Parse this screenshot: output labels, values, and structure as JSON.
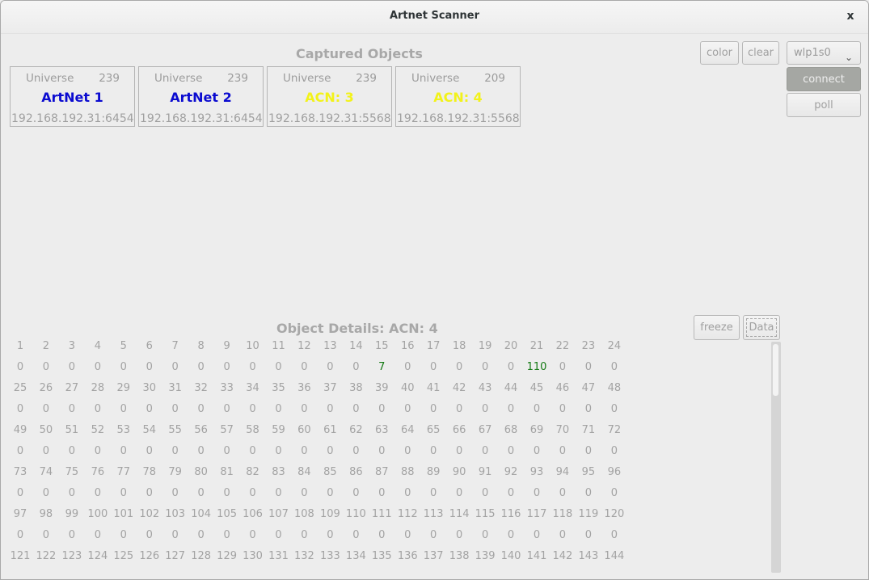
{
  "window": {
    "title": "Artnet Scanner",
    "close_label": "x"
  },
  "captured": {
    "title": "Captured Objects",
    "objects": [
      {
        "universe_label": "Universe",
        "universe": "239",
        "name": "ArtNet 1",
        "address": "192.168.192.31:6454",
        "color": "#0b0bd0"
      },
      {
        "universe_label": "Universe",
        "universe": "239",
        "name": "ArtNet 2",
        "address": "192.168.192.31:6454",
        "color": "#0b0bd0"
      },
      {
        "universe_label": "Universe",
        "universe": "239",
        "name": "ACN: 3",
        "address": "192.168.192.31:5568",
        "color": "#f2f21a"
      },
      {
        "universe_label": "Universe",
        "universe": "209",
        "name": "ACN: 4",
        "address": "192.168.192.31:5568",
        "color": "#f2f21a"
      }
    ]
  },
  "toolbar": {
    "color_label": "color",
    "clear_label": "clear",
    "interface_selected": "wlp1s0",
    "chevron_icon": "chevron-down-icon",
    "connect_label": "connect",
    "poll_label": "poll"
  },
  "details": {
    "title": "Object Details: ACN: 4",
    "freeze_label": "freeze",
    "data_label": "Data",
    "columns": 24,
    "visible_channels": 144,
    "channel_values": {
      "15": 7,
      "21": 110
    },
    "default_value": 0,
    "active_color": "#157a15"
  }
}
